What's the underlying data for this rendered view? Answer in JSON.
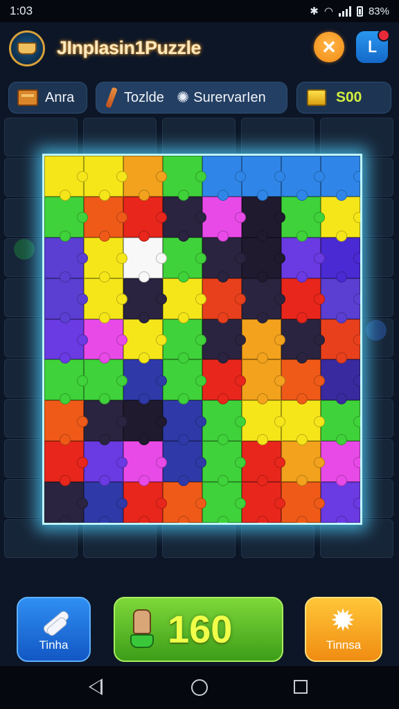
{
  "status_bar": {
    "time": "1:03",
    "battery_text": "83%"
  },
  "header": {
    "title": "JInplasin1Puzzle",
    "close_icon": "close-icon",
    "notify_icon": "notification-icon"
  },
  "chips": [
    {
      "label": "Anra",
      "icon": "box-icon"
    },
    {
      "label": "Tozlde",
      "icon": "brush-icon"
    },
    {
      "label": "SurervarIen",
      "icon": "sparkle-icon"
    },
    {
      "label": "S00",
      "icon": "gold-block-icon"
    }
  ],
  "board": {
    "rows": 9,
    "cols": 8,
    "pieces": [
      "#f5e61a",
      "#f5e61a",
      "#f2a21c",
      "#3fd23a",
      "#2f86e8",
      "#2f86e8",
      "#2f86e8",
      "#2f86e8",
      "#3fd23a",
      "#ef5a18",
      "#e8261c",
      "#2a2440",
      "#e84ae8",
      "#1f1a2e",
      "#3fd23a",
      "#f5e61a",
      "#5a3fd2",
      "#f5e61a",
      "#f8f8f8",
      "#3fd23a",
      "#2a2440",
      "#1f1a2e",
      "#6a3ae2",
      "#4a2ad2",
      "#5a3fd2",
      "#f5e61a",
      "#2a2440",
      "#f5e61a",
      "#e8401c",
      "#2a2440",
      "#e8261c",
      "#5a3fd2",
      "#6a3ae2",
      "#e84ae8",
      "#f5e61a",
      "#3fd23a",
      "#2a2440",
      "#f2a21c",
      "#2a2440",
      "#e8401c",
      "#3fd23a",
      "#3fd23a",
      "#2f3aa8",
      "#3fd23a",
      "#e8261c",
      "#f2a21c",
      "#ef5a18",
      "#3a2aa0",
      "#ef5a18",
      "#2a2440",
      "#1f1a2e",
      "#2f3aa8",
      "#3fd23a",
      "#f5e61a",
      "#f5e61a",
      "#3fd23a",
      "#e8261c",
      "#6a3ae2",
      "#e84ae8",
      "#2f3aa8",
      "#3fd23a",
      "#e8261c",
      "#f2a21c",
      "#e84ae8",
      "#2a2440",
      "#2f3aa8",
      "#e8261c",
      "#ef5a18",
      "#3fd23a",
      "#e8261c",
      "#ef5a18",
      "#6a3ae2"
    ]
  },
  "bottom": {
    "left_label": "Tinha",
    "left_icon": "feather-icon",
    "score": "160",
    "score_icon": "glove-icon",
    "right_label": "Tinnsa",
    "right_icon": "gear-icon"
  },
  "nav": {
    "back_icon": "back-icon",
    "home_icon": "home-icon",
    "recent_icon": "recent-apps-icon"
  }
}
